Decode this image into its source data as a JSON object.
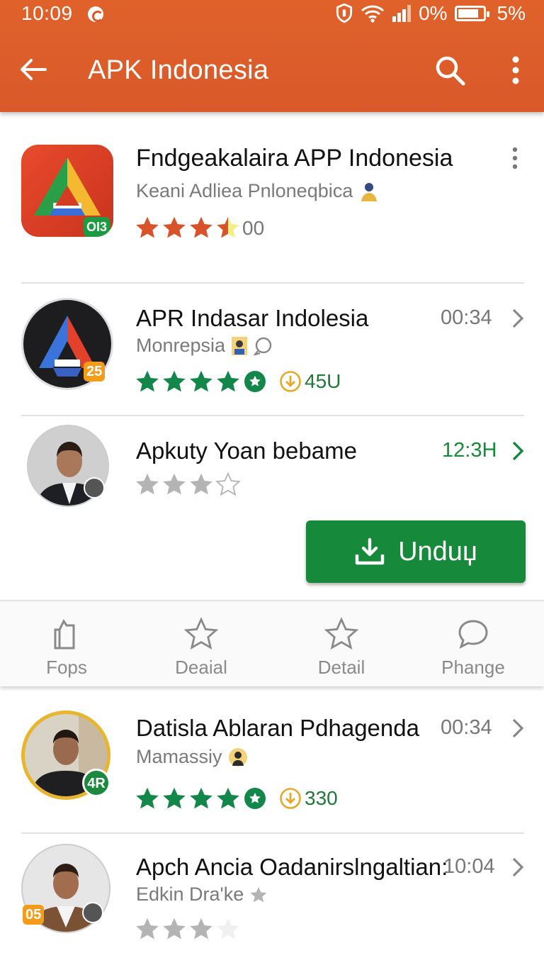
{
  "status_bar": {
    "time": "10:09",
    "signal_pct": "0%",
    "battery_pct": "5%"
  },
  "toolbar": {
    "title": "APK Indonesia",
    "back_icon": "arrow-left-icon",
    "search_icon": "search-icon",
    "more_icon": "more-vertical-icon"
  },
  "colors": {
    "header": "#d9592a",
    "accent_green": "#168a3a",
    "star_orange": "#d9532a",
    "star_green": "#13864a"
  },
  "featured": {
    "title": "Fndgeakalaira APP Indonesia",
    "subtitle": "Keani Adliea Pnloneqbica",
    "rating_text": "00",
    "badge": "ΟΙ3",
    "rating": 3.5
  },
  "items": [
    {
      "title": "APR Indasar Indolesia",
      "subtitle": "Monrepsia",
      "time": "00:34",
      "badge": "25",
      "downloads": "45U",
      "rating": 5
    },
    {
      "title": "Apkuty Yoan bebame",
      "time": "12:3H",
      "rating": 3.5
    },
    {
      "title": "Datisla Ablaran Pdhagenda",
      "subtitle": "Mamassiy",
      "time": "00:34",
      "badge": "4R",
      "downloads": "330",
      "rating": 5
    },
    {
      "title": "Apch Ancia Oadanirslngaltian:",
      "subtitle": "Edkin Dra'ke",
      "time": "10:04",
      "badge": "05",
      "rating": 3
    }
  ],
  "download_button": {
    "label": "Unduџ"
  },
  "bottom_nav": [
    {
      "label": "Fops",
      "icon": "bag-icon"
    },
    {
      "label": "Deaial",
      "icon": "star-icon"
    },
    {
      "label": "Detail",
      "icon": "star-icon"
    },
    {
      "label": "Phange",
      "icon": "chat-icon"
    }
  ]
}
